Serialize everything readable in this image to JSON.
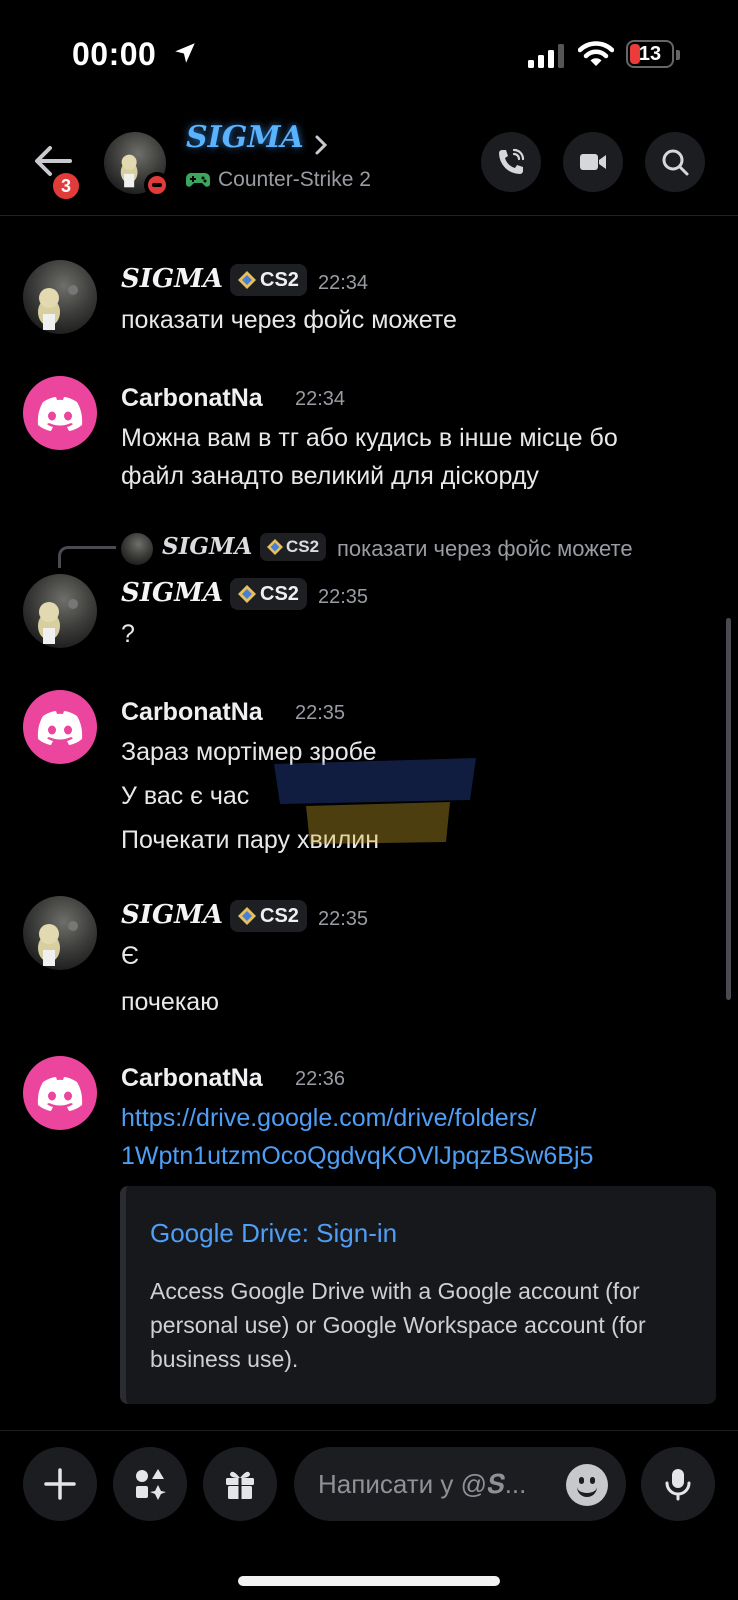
{
  "status_bar": {
    "time": "00:00",
    "battery": "13",
    "icons": [
      "location-arrow-icon",
      "cellular-signal-icon",
      "wifi-icon",
      "battery-icon"
    ]
  },
  "header": {
    "unread_count": "3",
    "name": "SIGMA",
    "activity": "Counter-Strike 2",
    "icons": [
      "back-arrow-icon",
      "chevron-right-icon",
      "gamepad-icon",
      "phone-call-icon",
      "video-camera-icon",
      "search-icon"
    ],
    "status": "do-not-disturb"
  },
  "messages": [
    {
      "author": "SIGMA",
      "tag": "CS2",
      "time": "22:34",
      "lines": [
        "показати через фойс можете"
      ]
    },
    {
      "author": "CarbonatNa",
      "time": "22:34",
      "lines": [
        "Можна вам в тг або кудись в інше місце бо",
        "файл занадто великий для діскорду"
      ]
    },
    {
      "reply": {
        "author": "SIGMA",
        "tag": "CS2",
        "text": "показати через фойс можете"
      },
      "author": "SIGMA",
      "tag": "CS2",
      "time": "22:35",
      "lines": [
        "?"
      ]
    },
    {
      "author": "CarbonatNa",
      "time": "22:35",
      "lines": [
        "Зараз мортімер зробе",
        "У вас є час",
        "Почекати пару хвилин"
      ]
    },
    {
      "author": "SIGMA",
      "tag": "CS2",
      "time": "22:35",
      "lines": [
        "Є",
        "почекаю"
      ]
    },
    {
      "author": "CarbonatNa",
      "time": "22:36",
      "link_lines": [
        "https://drive.google.com/drive/folders/",
        "1Wptn1utzmOcoQgdvqKOVlJpqzBSw6Bj5"
      ],
      "embed": {
        "title": "Google Drive: Sign-in",
        "description": "Access Google Drive with a Google account (for personal use) or Google Workspace account (for business use)."
      }
    }
  ],
  "composer": {
    "placeholder": "Написати у @𝑺...",
    "icons": [
      "plus-icon",
      "apps-icon",
      "gift-icon",
      "emoji-icon",
      "microphone-icon"
    ]
  },
  "colors": {
    "background": "#000000",
    "link": "#4f9ef5",
    "discord_avatar": "#eb459e",
    "sigma_name_glow": "#5ab3ff",
    "badge_red": "#e33a3a"
  }
}
